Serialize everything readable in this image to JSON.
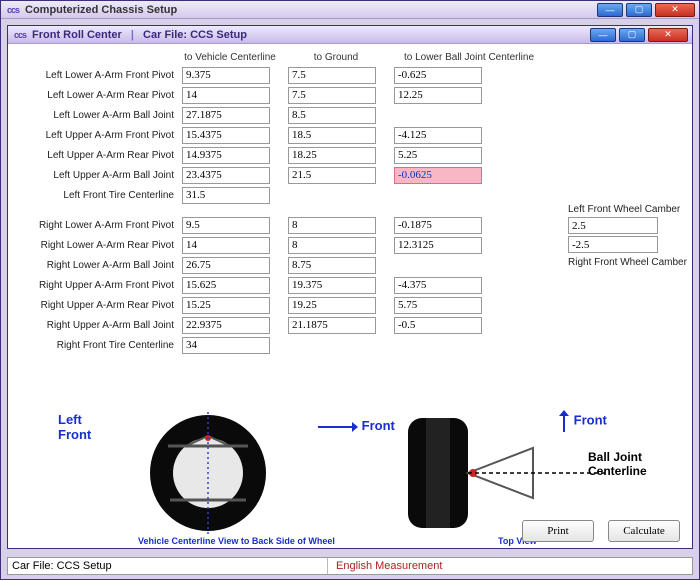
{
  "outer": {
    "title": "Computerized Chassis Setup",
    "icon": "ccs"
  },
  "inner": {
    "title_left": "Front Roll Center",
    "title_right": "Car File: CCS Setup",
    "icon": "ccs"
  },
  "columns": {
    "c1": "to Vehicle Centerline",
    "c2": "to Ground",
    "c3": "to Lower Ball Joint Centerline"
  },
  "rows_left": [
    {
      "label": "Left Lower A-Arm Front Pivot",
      "v1": "9.375",
      "v2": "7.5",
      "v3": "-0.625"
    },
    {
      "label": "Left Lower A-Arm Rear Pivot",
      "v1": "14",
      "v2": "7.5",
      "v3": "12.25"
    },
    {
      "label": "Left Lower A-Arm Ball Joint",
      "v1": "27.1875",
      "v2": "8.5",
      "v3": ""
    },
    {
      "label": "Left Upper A-Arm Front Pivot",
      "v1": "15.4375",
      "v2": "18.5",
      "v3": "-4.125"
    },
    {
      "label": "Left Upper A-Arm Rear Pivot",
      "v1": "14.9375",
      "v2": "18.25",
      "v3": "5.25"
    },
    {
      "label": "Left Upper A-Arm Ball Joint",
      "v1": "23.4375",
      "v2": "21.5",
      "v3": "-0.0625",
      "highlight": true
    },
    {
      "label": "Left Front Tire Centerline",
      "v1": "31.5",
      "v2": "",
      "v3": ""
    }
  ],
  "rows_right": [
    {
      "label": "Right Lower A-Arm Front Pivot",
      "v1": "9.5",
      "v2": "8",
      "v3": "-0.1875"
    },
    {
      "label": "Right Lower A-Arm Rear Pivot",
      "v1": "14",
      "v2": "8",
      "v3": "12.3125"
    },
    {
      "label": "Right Lower A-Arm Ball Joint",
      "v1": "26.75",
      "v2": "8.75",
      "v3": ""
    },
    {
      "label": "Right Upper A-Arm Front Pivot",
      "v1": "15.625",
      "v2": "19.375",
      "v3": "-4.375"
    },
    {
      "label": "Right Upper A-Arm Rear Pivot",
      "v1": "15.25",
      "v2": "19.25",
      "v3": "5.75"
    },
    {
      "label": "Right Upper A-Arm Ball Joint",
      "v1": "22.9375",
      "v2": "21.1875",
      "v3": "-0.5"
    },
    {
      "label": "Right Front Tire Centerline",
      "v1": "34",
      "v2": "",
      "v3": ""
    }
  ],
  "camber": {
    "left_label": "Left Front Wheel Camber",
    "left_val1": "2.5",
    "left_val2": "-2.5",
    "right_label": "Right Front Wheel Camber"
  },
  "diagram": {
    "left_front": "Left\nFront",
    "front": "Front",
    "balljoint": "Ball Joint\nCenterline",
    "caption1": "Vehicle Centerline View to Back Side of Wheel",
    "caption2": "Top View"
  },
  "buttons": {
    "print": "Print",
    "calculate": "Calculate"
  },
  "status": {
    "file": "Car File: CCS Setup",
    "units": "English Measurement"
  }
}
